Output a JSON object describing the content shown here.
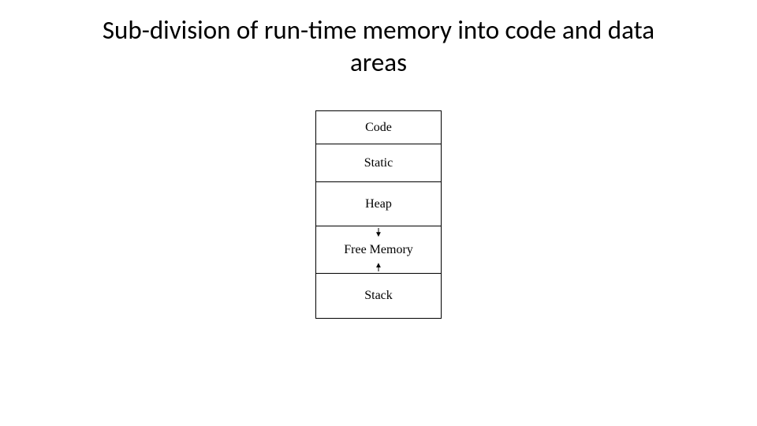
{
  "title": "Sub-division of run-time memory into code and data areas",
  "diagram": {
    "cells": [
      {
        "label": "Code"
      },
      {
        "label": "Static"
      },
      {
        "label": "Heap"
      },
      {
        "label": "Free Memory"
      },
      {
        "label": "Stack"
      }
    ]
  }
}
